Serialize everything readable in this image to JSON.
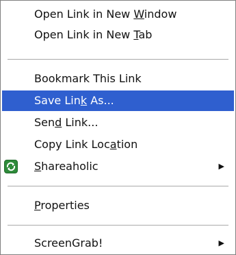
{
  "menu": {
    "items": [
      {
        "id": "open-new-window",
        "prefix": "Open Link in New ",
        "mnemonic": "W",
        "suffix": "indow"
      },
      {
        "id": "open-new-tab",
        "prefix": "Open Link in New ",
        "mnemonic": "T",
        "suffix": "ab"
      },
      {
        "id": "bookmark-link",
        "prefix": "Bookmark This ",
        "mnemonic": "L",
        "suffix": "ink"
      },
      {
        "id": "save-link-as",
        "prefix": "Save Lin",
        "mnemonic": "k",
        "suffix": " As..."
      },
      {
        "id": "send-link",
        "prefix": "Sen",
        "mnemonic": "d",
        "suffix": " Link..."
      },
      {
        "id": "copy-link-location",
        "prefix": "Copy Link Loc",
        "mnemonic": "a",
        "suffix": "tion"
      },
      {
        "id": "shareaholic",
        "prefix": "",
        "mnemonic": "S",
        "suffix": "hareaholic"
      },
      {
        "id": "properties",
        "prefix": "",
        "mnemonic": "P",
        "suffix": "roperties"
      },
      {
        "id": "screengrab",
        "prefix": "ScreenGrab!",
        "mnemonic": "",
        "suffix": ""
      }
    ],
    "highlighted": "save-link-as",
    "submenu_arrow": "▶",
    "highlight_color": "#2f5fcf"
  }
}
